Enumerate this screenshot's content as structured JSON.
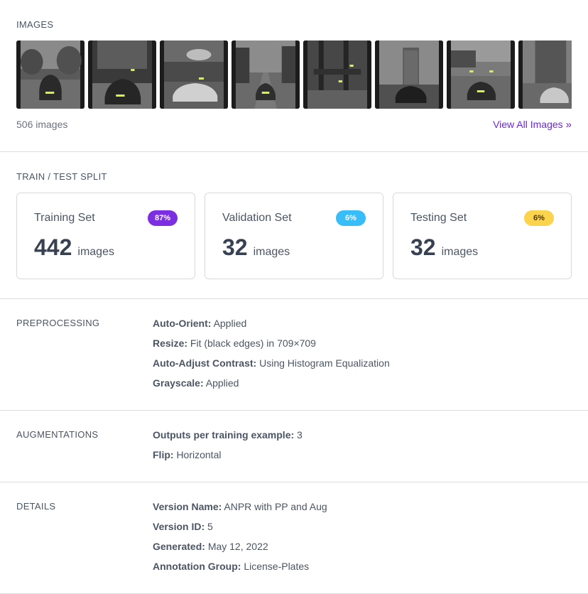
{
  "images": {
    "title": "IMAGES",
    "count_text": "506 images",
    "view_all_label": "View All Images",
    "view_all_icon": "double-chevron-right-icon",
    "thumbnails": [
      {
        "name": "thumb-1"
      },
      {
        "name": "thumb-2"
      },
      {
        "name": "thumb-3"
      },
      {
        "name": "thumb-4"
      },
      {
        "name": "thumb-5"
      },
      {
        "name": "thumb-6"
      },
      {
        "name": "thumb-7"
      },
      {
        "name": "thumb-8"
      }
    ]
  },
  "split": {
    "title": "TRAIN / TEST SPLIT",
    "cards": [
      {
        "name": "Training Set",
        "badge": "87%",
        "count": "442",
        "unit": "images",
        "badge_bg": "#7c2fe0",
        "badge_fg": "#ffffff"
      },
      {
        "name": "Validation Set",
        "badge": "6%",
        "count": "32",
        "unit": "images",
        "badge_bg": "#38bdf8",
        "badge_fg": "#ffffff"
      },
      {
        "name": "Testing Set",
        "badge": "6%",
        "count": "32",
        "unit": "images",
        "badge_bg": "#fcd34d",
        "badge_fg": "#4b3b0a"
      }
    ]
  },
  "preprocessing": {
    "title": "PREPROCESSING",
    "rows": [
      {
        "key": "Auto-Orient:",
        "value": "Applied"
      },
      {
        "key": "Resize:",
        "value": "Fit (black edges) in 709×709"
      },
      {
        "key": "Auto-Adjust Contrast:",
        "value": "Using Histogram Equalization"
      },
      {
        "key": "Grayscale:",
        "value": "Applied"
      }
    ]
  },
  "augmentations": {
    "title": "AUGMENTATIONS",
    "rows": [
      {
        "key": "Outputs per training example:",
        "value": "3"
      },
      {
        "key": "Flip:",
        "value": "Horizontal"
      }
    ]
  },
  "details": {
    "title": "DETAILS",
    "rows": [
      {
        "key": "Version Name:",
        "value": "ANPR with PP and Aug"
      },
      {
        "key": "Version ID:",
        "value": "5"
      },
      {
        "key": "Generated:",
        "value": "May 12, 2022"
      },
      {
        "key": "Annotation Group:",
        "value": "License-Plates"
      }
    ]
  },
  "colors": {
    "accent": "#6d28d9",
    "plate_highlight": "#d4f542"
  }
}
